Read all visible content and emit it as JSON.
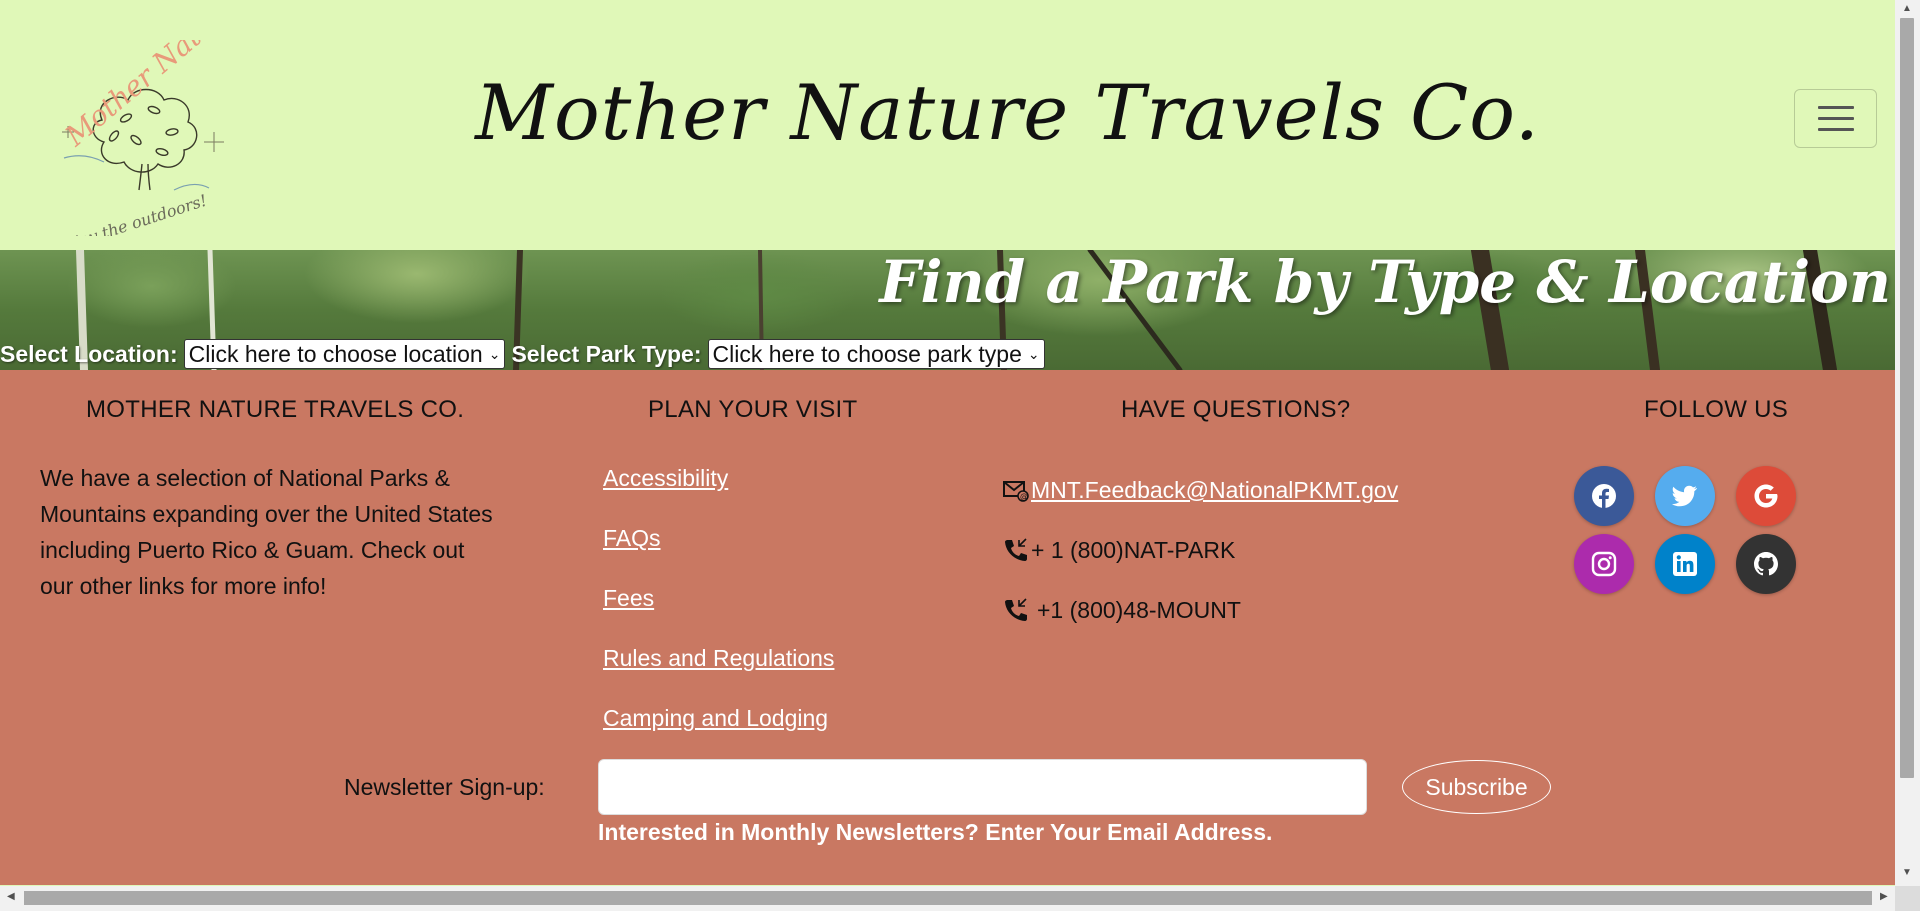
{
  "header": {
    "site_title": "Mother Nature Travels Co.",
    "logo_top_text": "Mother Nature",
    "logo_bottom_text": "enjoy the outdoors!"
  },
  "hero": {
    "title": "Find a Park by Type & Location",
    "location_label": "Select Location:",
    "location_selected": "Click here to choose location",
    "park_type_label": "Select Park Type:",
    "park_type_selected": "Click here to choose park type"
  },
  "footer": {
    "about": {
      "heading": "MOTHER NATURE TRAVELS CO.",
      "text": "We have a selection of National Parks & Mountains expanding over the United States including Puerto Rico & Guam. Check out our other links for more info!"
    },
    "plan": {
      "heading": "PLAN YOUR VISIT",
      "links": [
        "Accessibility",
        "FAQs",
        "Fees",
        "Rules and Regulations",
        "Camping and Lodging"
      ]
    },
    "questions": {
      "heading": "HAVE QUESTIONS?",
      "email": "MNT.Feedback@NationalPKMT.gov",
      "phone1": "+ 1 (800)NAT-PARK",
      "phone2": "+1 (800)48-MOUNT"
    },
    "follow": {
      "heading": "FOLLOW US",
      "icons": [
        {
          "name": "facebook-icon",
          "color": "#3b5998"
        },
        {
          "name": "twitter-icon",
          "color": "#55acee"
        },
        {
          "name": "google-icon",
          "color": "#dd4b39"
        },
        {
          "name": "instagram-icon",
          "color": "#ac2bac"
        },
        {
          "name": "linkedin-icon",
          "color": "#0082ca"
        },
        {
          "name": "github-icon",
          "color": "#333333"
        }
      ]
    },
    "newsletter": {
      "label": "Newsletter Sign-up:",
      "input_value": "",
      "button": "Subscribe",
      "help": "Interested in Monthly Newsletters? Enter Your Email Address."
    }
  }
}
